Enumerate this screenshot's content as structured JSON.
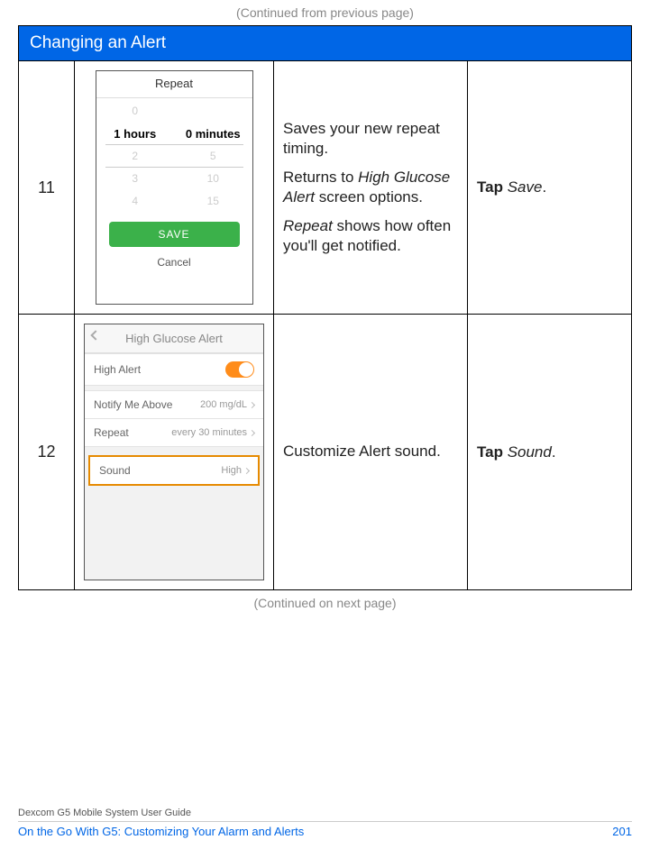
{
  "continued_from": "(Continued from previous page)",
  "continued_on": "(Continued on next page)",
  "table_header": "Changing an Alert",
  "rows": [
    {
      "step": "11",
      "desc": {
        "p1": "Saves your new repeat timing.",
        "p2_pre": "Returns to ",
        "p2_em": "High Glucose Alert",
        "p2_post": " screen options.",
        "p3_em": "Repeat",
        "p3_post": " shows how often you'll get notified."
      },
      "action": {
        "bold": "Tap ",
        "em": "Save",
        "post": "."
      },
      "screenshot": {
        "title": "Repeat",
        "picker": {
          "hours_faded_above": "0",
          "hours_sel": "1",
          "hours_label": "hours",
          "hours_faded_below": [
            "2",
            "3",
            "4"
          ],
          "minutes_sel": "0",
          "minutes_label": "minutes",
          "minutes_faded_below": [
            "5",
            "10",
            "15"
          ]
        },
        "save_button": "SAVE",
        "cancel": "Cancel"
      }
    },
    {
      "step": "12",
      "desc": {
        "p1": "Customize Alert sound."
      },
      "action": {
        "bold": "Tap ",
        "em": "Sound",
        "post": "."
      },
      "screenshot": {
        "nav_title": "High Glucose Alert",
        "row_high_alert": "High Alert",
        "row_notify_label": "Notify Me Above",
        "row_notify_value": "200 mg/dL",
        "row_repeat_label": "Repeat",
        "row_repeat_value": "every 30 minutes",
        "row_sound_label": "Sound",
        "row_sound_value": "High"
      }
    }
  ],
  "footer": {
    "guide": "Dexcom G5 Mobile System User Guide",
    "chapter": "On the Go With G5: Customizing Your Alarm and Alerts",
    "page": "201"
  }
}
